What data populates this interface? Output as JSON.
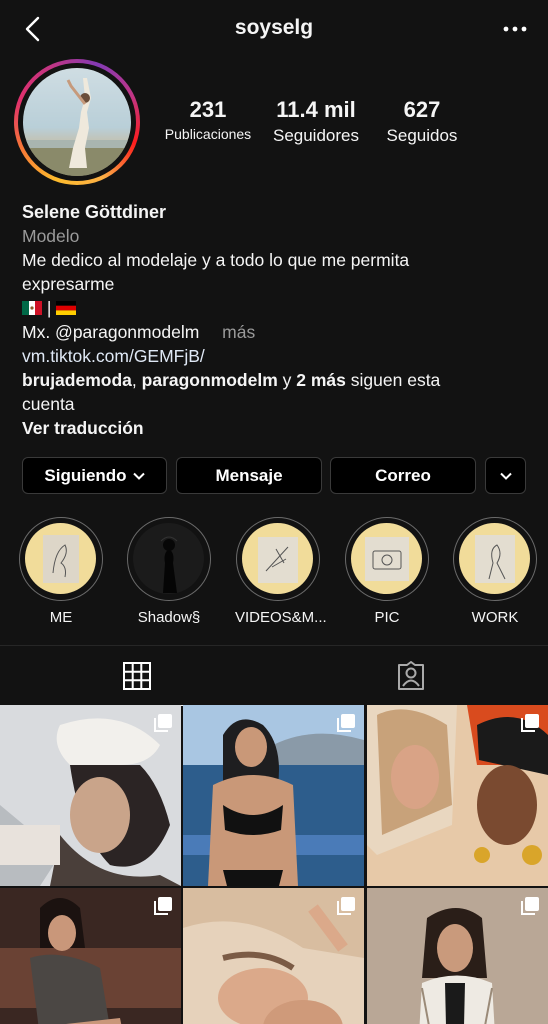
{
  "header": {
    "username": "soyselg",
    "back_icon": "back-chevron-icon",
    "more_icon": "more-dots-icon"
  },
  "stats": [
    {
      "value": "231",
      "label": "Publicaciones"
    },
    {
      "value": "11.4 mil",
      "label": "Seguidores"
    },
    {
      "value": "627",
      "label": "Seguidos"
    }
  ],
  "bio": {
    "name": "Selene Göttdiner",
    "category": "Modelo",
    "text_line1": "Me dedico al modelaje y a todo lo que me permita",
    "text_line2": "expresarme",
    "flag_separator": "|",
    "mention_prefix": "Mx. @paragonmodelm",
    "more": "más",
    "link": "vm.tiktok.com/GEMFjB/",
    "followed_by_user1": "brujademoda",
    "followed_by_sep": ",",
    "followed_by_user2": "paragonmodelm",
    "followed_by_and": "y",
    "followed_by_more": "2 más",
    "followed_by_tail": "siguen esta",
    "followed_by_tail2": "cuenta",
    "translate": "Ver traducción"
  },
  "buttons": {
    "following": "Siguiendo",
    "message": "Mensaje",
    "email": "Correo"
  },
  "highlights": [
    {
      "label": "ME"
    },
    {
      "label": "Shadow§"
    },
    {
      "label": "VIDEOS&M..."
    },
    {
      "label": "PIC"
    },
    {
      "label": "WORK"
    }
  ],
  "tabs": {
    "grid_icon": "grid-icon",
    "tagged_icon": "tagged-person-icon"
  },
  "colors": {
    "background": "#121212",
    "highlight_bg": "#f1dc9a",
    "text": "#f5f5f5",
    "muted": "#9a9a9a"
  }
}
